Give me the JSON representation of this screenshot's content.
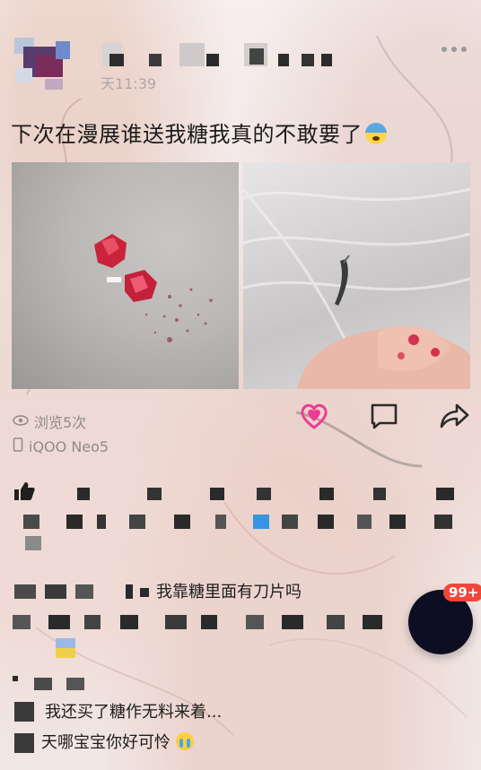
{
  "post": {
    "time": "天11:39",
    "text": "下次在漫展谁送我糖我真的不敢要了",
    "emoji": "fearful-face-icon",
    "images": [
      {
        "alt": "crushed red candy pieces"
      },
      {
        "alt": "small blade held in fingers"
      }
    ]
  },
  "meta": {
    "views": "浏览5次",
    "device": "iQOO Neo5"
  },
  "actions": {
    "like": "heart-icon",
    "comment": "comment-icon",
    "share": "share-icon"
  },
  "comments": [
    {
      "text": "我靠糖里面有刀片吗"
    },
    {
      "text": "我还买了糖作无料来着..."
    },
    {
      "text": "天哪宝宝你好可怜"
    }
  ],
  "fab": {
    "badge": "99+"
  },
  "colors": {
    "accent": "#ec3d95",
    "badge": "#f2463a",
    "muted": "#8f8a8a"
  }
}
